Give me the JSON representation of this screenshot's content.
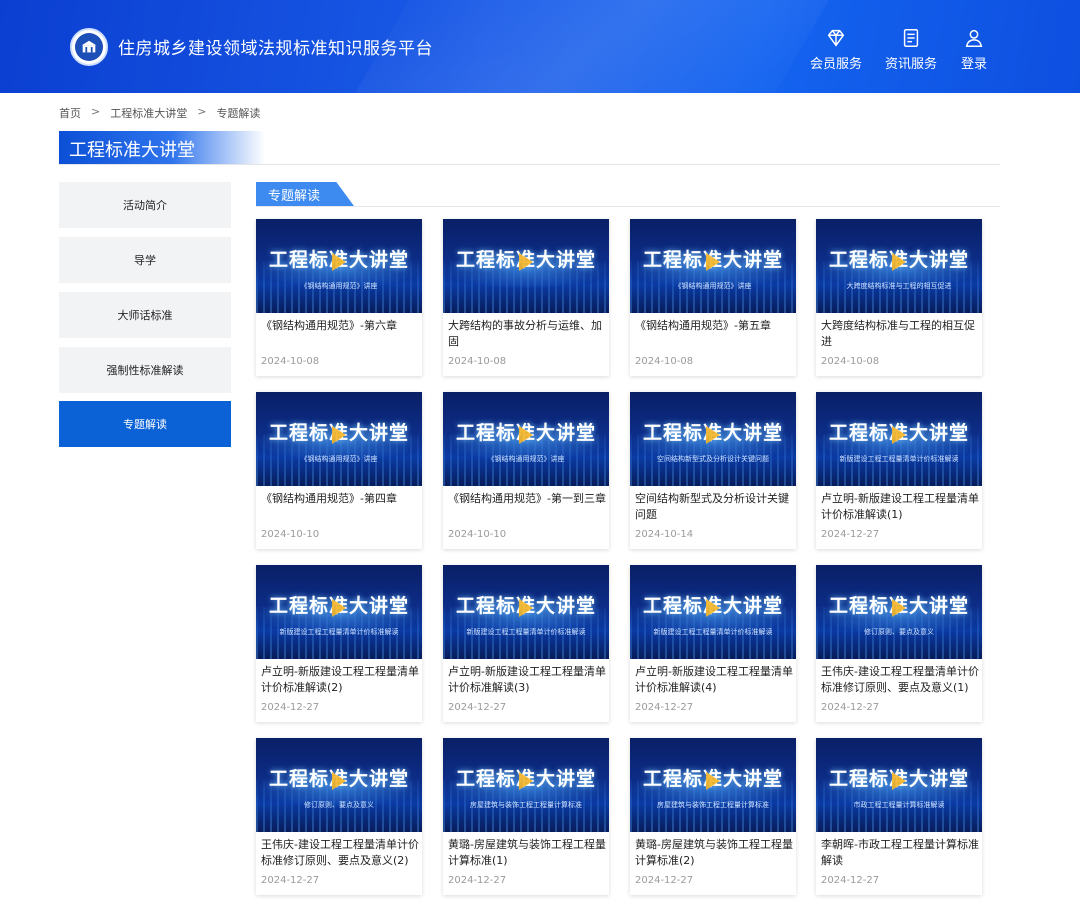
{
  "header": {
    "site_title": "住房城乡建设领域法规标准知识服务平台",
    "nav": [
      {
        "label": "会员服务",
        "icon": "diamond-icon"
      },
      {
        "label": "资讯服务",
        "icon": "document-icon"
      },
      {
        "label": "登录",
        "icon": "user-icon"
      }
    ]
  },
  "breadcrumb": [
    "首页",
    "工程标准大讲堂",
    "专题解读"
  ],
  "breadcrumb_sep": ">",
  "section_title": "工程标准大讲堂",
  "sidebar": [
    {
      "label": "活动简介",
      "active": false
    },
    {
      "label": "导学",
      "active": false
    },
    {
      "label": "大师话标准",
      "active": false
    },
    {
      "label": "强制性标准解读",
      "active": false
    },
    {
      "label": "专题解读",
      "active": true
    }
  ],
  "subtab": "专题解读",
  "thumb_title": "工程标准大讲堂",
  "cards": [
    {
      "title": "《钢结构通用规范》-第六章",
      "date": "2024-10-08",
      "thumb_sub": "《钢结构通用规范》讲座"
    },
    {
      "title": "大跨结构的事故分析与运维、加固",
      "date": "2024-10-08",
      "thumb_sub": ""
    },
    {
      "title": "《钢结构通用规范》-第五章",
      "date": "2024-10-08",
      "thumb_sub": "《钢结构通用规范》讲座"
    },
    {
      "title": "大跨度结构标准与工程的相互促进",
      "date": "2024-10-08",
      "thumb_sub": "大跨度结构标准与工程的相互促进"
    },
    {
      "title": "《钢结构通用规范》-第四章",
      "date": "2024-10-10",
      "thumb_sub": "《钢结构通用规范》讲座"
    },
    {
      "title": "《钢结构通用规范》-第一到三章",
      "date": "2024-10-10",
      "thumb_sub": "《钢结构通用规范》讲座"
    },
    {
      "title": "空间结构新型式及分析设计关键问题",
      "date": "2024-10-14",
      "thumb_sub": "空间结构新型式及分析设计关键问题"
    },
    {
      "title": "卢立明-新版建设工程工程量清单计价标准解读(1)",
      "date": "2024-12-27",
      "thumb_sub": "新版建设工程工程量清单计价标准解读"
    },
    {
      "title": "卢立明-新版建设工程工程量清单计价标准解读(2)",
      "date": "2024-12-27",
      "thumb_sub": "新版建设工程工程量清单计价标准解读"
    },
    {
      "title": "卢立明-新版建设工程工程量清单计价标准解读(3)",
      "date": "2024-12-27",
      "thumb_sub": "新版建设工程工程量清单计价标准解读"
    },
    {
      "title": "卢立明-新版建设工程工程量清单计价标准解读(4)",
      "date": "2024-12-27",
      "thumb_sub": "新版建设工程工程量清单计价标准解读"
    },
    {
      "title": "王伟庆-建设工程工程量清单计价标准修订原则、要点及意义(1)",
      "date": "2024-12-27",
      "thumb_sub": "修订原则、要点及意义"
    },
    {
      "title": "王伟庆-建设工程工程量清单计价标准修订原则、要点及意义(2)",
      "date": "2024-12-27",
      "thumb_sub": "修订原则、要点及意义"
    },
    {
      "title": "黄璐-房屋建筑与装饰工程工程量计算标准(1)",
      "date": "2024-12-27",
      "thumb_sub": "房屋建筑与装饰工程工程量计算标准"
    },
    {
      "title": "黄璐-房屋建筑与装饰工程工程量计算标准(2)",
      "date": "2024-12-27",
      "thumb_sub": "房屋建筑与装饰工程工程量计算标准"
    },
    {
      "title": "李朝晖-市政工程工程量计算标准解读",
      "date": "2024-12-27",
      "thumb_sub": "市政工程工程量计算标准解读"
    }
  ]
}
